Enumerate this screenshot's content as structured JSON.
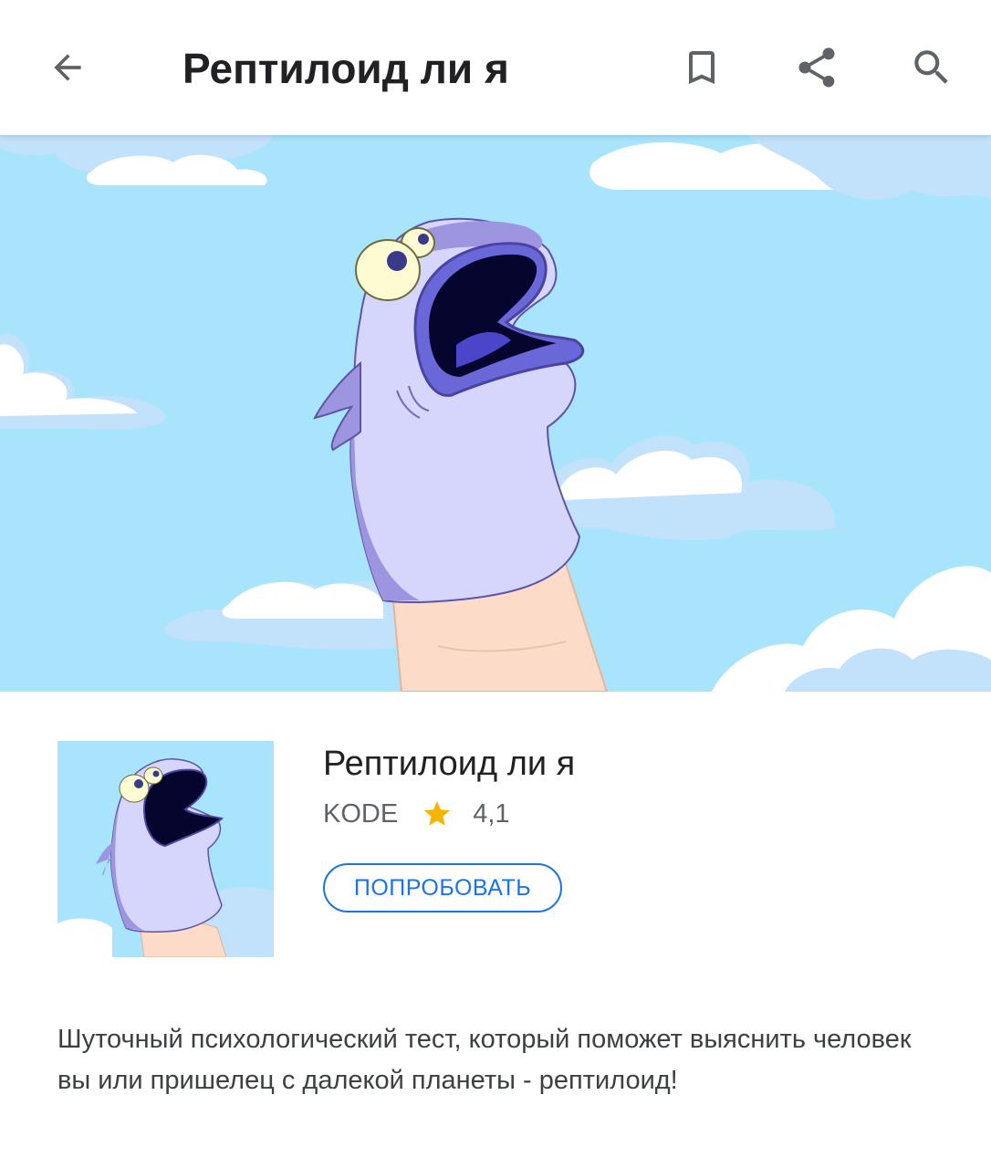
{
  "header": {
    "title": "Рептилоид ли я",
    "back_icon": "arrow-back-icon",
    "bookmark_icon": "bookmark-icon",
    "share_icon": "share-icon",
    "search_icon": "search-icon"
  },
  "hero": {
    "illustration": "sock-puppet-in-sky"
  },
  "app": {
    "name": "Рептилоид ли я",
    "developer": "KODE",
    "rating": "4,1",
    "try_button": "ПОПРОБОВАТЬ",
    "description": "Шуточный психологический тест, который поможет выяснить человек вы или пришелец с далекой планеты - рептилоид!"
  },
  "colors": {
    "accent": "#1a73e8",
    "sky": "#a8e4fb",
    "star": "#f4b400",
    "puppet": "#c9c8f7",
    "puppet_dark": "#9088d9"
  }
}
